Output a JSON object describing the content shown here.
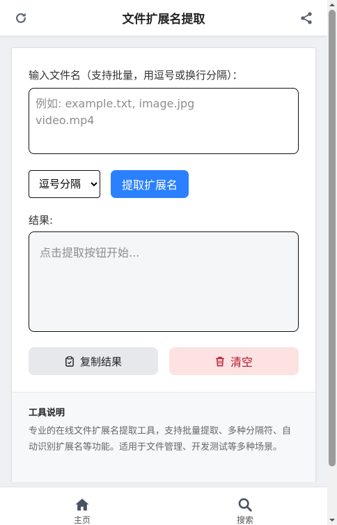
{
  "header": {
    "title": "文件扩展名提取",
    "left_icon": "refresh-icon",
    "right_icon": "share-icon"
  },
  "input": {
    "label": "输入文件名（支持批量，用逗号或换行分隔）：",
    "placeholder": "例如: example.txt, image.jpg\nvideo.mp4",
    "value": ""
  },
  "separator_select": {
    "selected": "逗号分隔",
    "options": [
      "逗号分隔"
    ]
  },
  "extract_button": {
    "label": "提取扩展名"
  },
  "result": {
    "label": "结果:",
    "placeholder": "点击提取按钮开始...",
    "value": ""
  },
  "copy_button": {
    "label": "复制结果",
    "icon": "clipboard-icon"
  },
  "clear_button": {
    "label": "清空",
    "icon": "trash-icon"
  },
  "info": {
    "title": "工具说明",
    "text": "专业的在线文件扩展名提取工具，支持批量提取、多种分隔符、自动识别扩展名等功能。适用于文件管理、开发测试等多种场景。"
  },
  "bottom_nav": {
    "items": [
      {
        "label": "主页",
        "icon": "home-icon"
      },
      {
        "label": "搜索",
        "icon": "search-icon"
      }
    ]
  },
  "colors": {
    "primary": "#2b80ff",
    "danger_bg": "#fde2e2",
    "danger_text": "#b1172c",
    "neutral_btn": "#e6e8ec"
  }
}
